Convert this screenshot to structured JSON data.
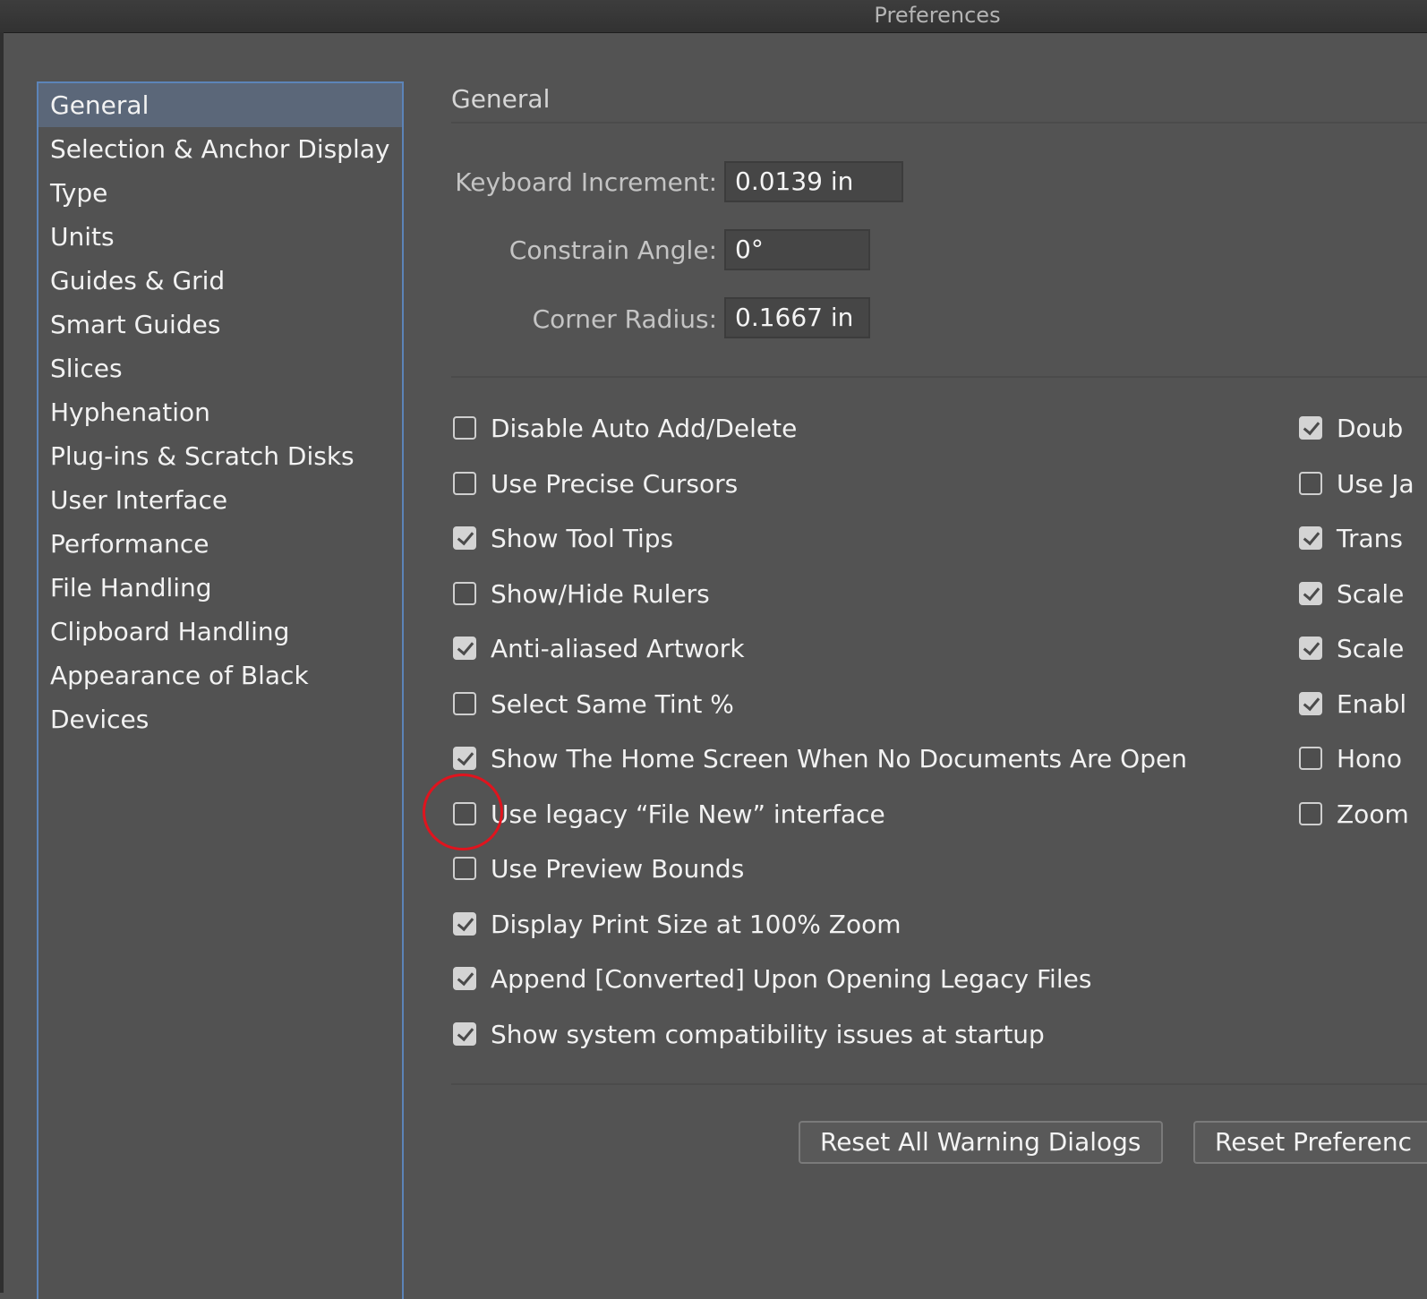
{
  "window": {
    "title": "Preferences"
  },
  "sidebar": {
    "items": [
      {
        "label": "General",
        "selected": true
      },
      {
        "label": "Selection & Anchor Display"
      },
      {
        "label": "Type"
      },
      {
        "label": "Units"
      },
      {
        "label": "Guides & Grid"
      },
      {
        "label": "Smart Guides"
      },
      {
        "label": "Slices"
      },
      {
        "label": "Hyphenation"
      },
      {
        "label": "Plug-ins & Scratch Disks"
      },
      {
        "label": "User Interface"
      },
      {
        "label": "Performance"
      },
      {
        "label": "File Handling"
      },
      {
        "label": "Clipboard Handling"
      },
      {
        "label": "Appearance of Black"
      },
      {
        "label": "Devices"
      }
    ]
  },
  "panel": {
    "title": "General",
    "fields": {
      "keyboard_increment": {
        "label": "Keyboard Increment:",
        "value": "0.0139 in"
      },
      "constrain_angle": {
        "label": "Constrain Angle:",
        "value": "0°"
      },
      "corner_radius": {
        "label": "Corner Radius:",
        "value": "0.1667 in"
      }
    },
    "left_options": [
      {
        "label": "Disable Auto Add/Delete",
        "checked": false
      },
      {
        "label": "Use Precise Cursors",
        "checked": false
      },
      {
        "label": "Show Tool Tips",
        "checked": true
      },
      {
        "label": "Show/Hide Rulers",
        "checked": false
      },
      {
        "label": "Anti-aliased Artwork",
        "checked": true
      },
      {
        "label": "Select Same Tint %",
        "checked": false
      },
      {
        "label": "Show The Home Screen When No Documents Are Open",
        "checked": true
      },
      {
        "label": "Use legacy “File New” interface",
        "checked": false
      },
      {
        "label": "Use Preview Bounds",
        "checked": false
      },
      {
        "label": "Display Print Size at 100% Zoom",
        "checked": true
      },
      {
        "label": "Append [Converted] Upon Opening Legacy Files",
        "checked": true
      },
      {
        "label": "Show system compatibility issues at startup",
        "checked": true
      }
    ],
    "right_options": [
      {
        "label": "Doub",
        "checked": true
      },
      {
        "label": "Use Ja",
        "checked": false
      },
      {
        "label": "Trans",
        "checked": true
      },
      {
        "label": "Scale",
        "checked": true
      },
      {
        "label": "Scale",
        "checked": true
      },
      {
        "label": "Enabl",
        "checked": true
      },
      {
        "label": "Hono",
        "checked": false
      },
      {
        "label": "Zoom",
        "checked": false
      }
    ],
    "buttons": {
      "reset_warnings": "Reset All Warning Dialogs",
      "reset_preferences": "Reset Preferenc"
    }
  },
  "annotation": {
    "color": "#e0141e"
  }
}
